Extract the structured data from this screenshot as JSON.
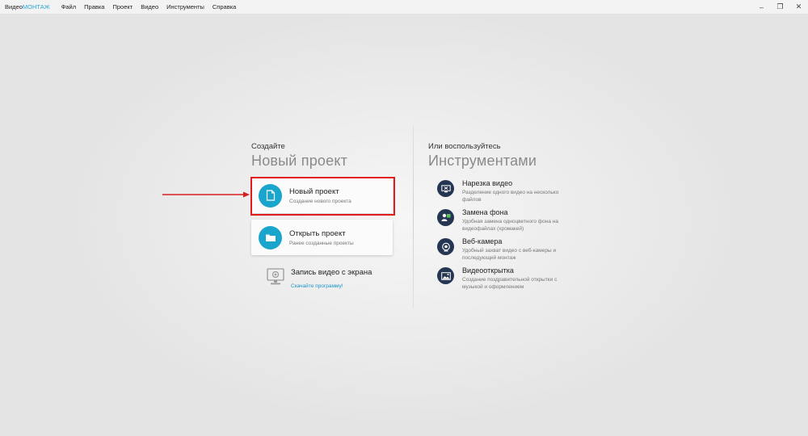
{
  "app": {
    "name_part1": "Видео",
    "name_part2": "МОНТАЖ"
  },
  "menu": [
    "Файл",
    "Правка",
    "Проект",
    "Видео",
    "Инструменты",
    "Справка"
  ],
  "window_controls": {
    "minimize": "–",
    "maximize": "❐",
    "close": "✕"
  },
  "left": {
    "small_heading": "Создайте",
    "big_heading": "Новый проект",
    "new_project": {
      "title": "Новый проект",
      "subtitle": "Создание нового проекта"
    },
    "open_project": {
      "title": "Открыть проект",
      "subtitle": "Ранее созданные проекты"
    },
    "record": {
      "title": "Запись видео с экрана",
      "link": "Скачайте программу!"
    }
  },
  "right": {
    "small_heading": "Или воспользуйтесь",
    "big_heading": "Инструментами",
    "tools": [
      {
        "title": "Нарезка видео",
        "desc": "Разделение одного видео на несколько файлов",
        "icon": "cut-video-icon"
      },
      {
        "title": "Замена фона",
        "desc": "Удобная замена одноцветного фона на видеофайлах (хромакей)",
        "icon": "chroma-key-icon"
      },
      {
        "title": "Веб-камера",
        "desc": "Удобный захват видео с веб-камеры и последующий монтаж",
        "icon": "webcam-icon"
      },
      {
        "title": "Видеооткрытка",
        "desc": "Создание поздравительной открытки с музыкой и оформлением",
        "icon": "postcard-icon"
      }
    ]
  },
  "colors": {
    "accent": "#1aa6cc",
    "tool_icon_bg": "#253652",
    "highlight": "#e01d1d",
    "link": "#1a95c9"
  }
}
